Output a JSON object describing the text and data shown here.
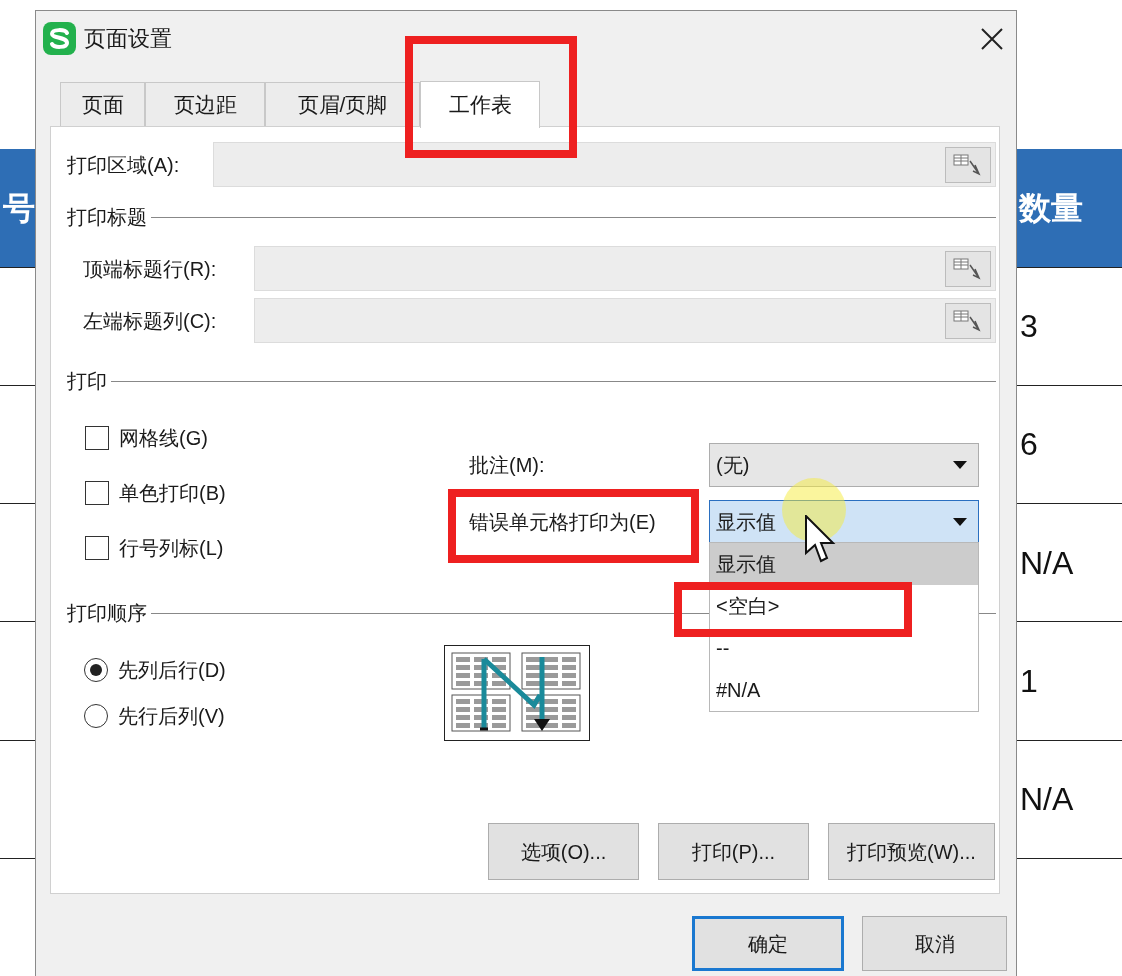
{
  "sheet": {
    "left_header": "号",
    "right_header": "数量",
    "right_cells": [
      "3",
      "6",
      "N/A",
      "1",
      "N/A"
    ]
  },
  "window": {
    "title": "页面设置"
  },
  "tabs": [
    {
      "label": "页面",
      "selected": false,
      "highlighted": false
    },
    {
      "label": "页边距",
      "selected": false,
      "highlighted": false
    },
    {
      "label": "页眉/页脚",
      "selected": false,
      "highlighted": false
    },
    {
      "label": "工作表",
      "selected": true,
      "highlighted": true
    }
  ],
  "print_area": {
    "label": "打印区域(A):"
  },
  "print_titles": {
    "heading": "打印标题",
    "rows": [
      {
        "label": "顶端标题行(R):"
      },
      {
        "label": "左端标题列(C):"
      }
    ]
  },
  "print": {
    "heading": "打印",
    "checkboxes": [
      {
        "label": "网格线(G)",
        "checked": false
      },
      {
        "label": "单色打印(B)",
        "checked": false
      },
      {
        "label": "行号列标(L)",
        "checked": false
      }
    ],
    "comments": {
      "label": "批注(M):",
      "value": "(无)"
    },
    "errors": {
      "label": "错误单元格打印为(E)",
      "value": "显示值",
      "highlighted": true,
      "expanded": true,
      "options": [
        {
          "label": "显示值",
          "selected": true,
          "highlighted": false
        },
        {
          "label": "<空白>",
          "selected": false,
          "highlighted": true
        },
        {
          "label": "--",
          "selected": false,
          "highlighted": false
        },
        {
          "label": "#N/A",
          "selected": false,
          "highlighted": false
        }
      ]
    }
  },
  "page_order": {
    "heading": "打印顺序",
    "radios": [
      {
        "label": "先列后行(D)",
        "selected": true
      },
      {
        "label": "先行后列(V)",
        "selected": false
      }
    ]
  },
  "buttons": [
    "选项(O)...",
    "打印(P)...",
    "打印预览(W)..."
  ],
  "footer_buttons": [
    {
      "label": "确定",
      "default": true
    },
    {
      "label": "取消",
      "default": false
    }
  ]
}
